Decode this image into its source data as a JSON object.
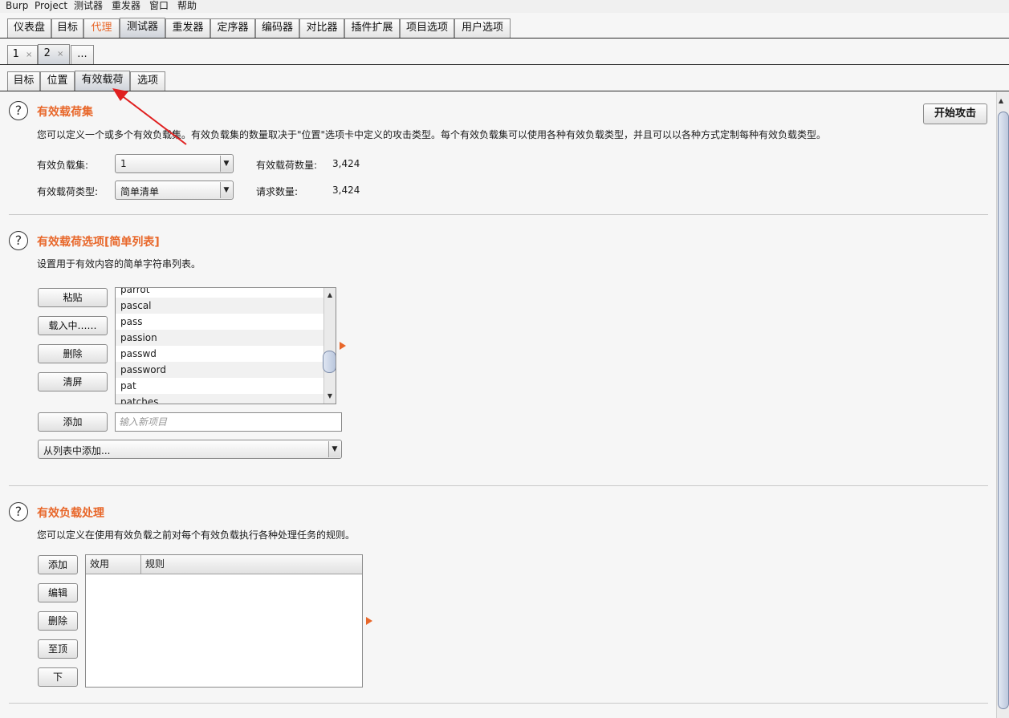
{
  "menu": [
    "Burp",
    "Project",
    "测试器",
    "重发器",
    "窗口",
    "帮助"
  ],
  "main_tabs": [
    "仪表盘",
    "目标",
    "代理",
    "测试器",
    "重发器",
    "定序器",
    "编码器",
    "对比器",
    "插件扩展",
    "项目选项",
    "用户选项"
  ],
  "attack_tabs": [
    {
      "label": "1",
      "close": "×"
    },
    {
      "label": "2",
      "close": "×"
    },
    {
      "label": "..."
    }
  ],
  "sub_tabs": [
    "目标",
    "位置",
    "有效载荷",
    "选项"
  ],
  "colors": {
    "accent": "#e8672a",
    "annotation_arrow": "#e02020"
  },
  "payload_sets": {
    "title": "有效载荷集",
    "description": "您可以定义一个或多个有效负载集。有效负载集的数量取决于\"位置\"选项卡中定义的攻击类型。每个有效负载集可以使用各种有效负载类型，并且可以以各种方式定制每种有效负载类型。",
    "start_attack": "开始攻击",
    "set_label": "有效负载集:",
    "set_value": "1",
    "type_label": "有效载荷类型:",
    "type_value": "简单清单",
    "count_label": "有效载荷数量:",
    "count_value": "3,424",
    "requests_label": "请求数量:",
    "requests_value": "3,424"
  },
  "payload_options": {
    "title": "有效载荷选项[简单列表]",
    "description": "设置用于有效内容的简单字符串列表。",
    "buttons": {
      "paste": "粘贴",
      "load": "载入中……",
      "remove": "删除",
      "clear": "清屏",
      "add": "添加"
    },
    "items": [
      "parrot",
      "pascal",
      "pass",
      "passion",
      "passwd",
      "password",
      "pat",
      "patches"
    ],
    "add_placeholder": "输入新项目",
    "add_from_list": "从列表中添加..."
  },
  "payload_processing": {
    "title": "有效负载处理",
    "description": "您可以定义在使用有效负载之前对每个有效负载执行各种处理任务的规则。",
    "buttons": {
      "add": "添加",
      "edit": "编辑",
      "remove": "删除",
      "up": "至顶",
      "down": "下"
    },
    "columns": [
      "效用",
      "规则"
    ]
  }
}
